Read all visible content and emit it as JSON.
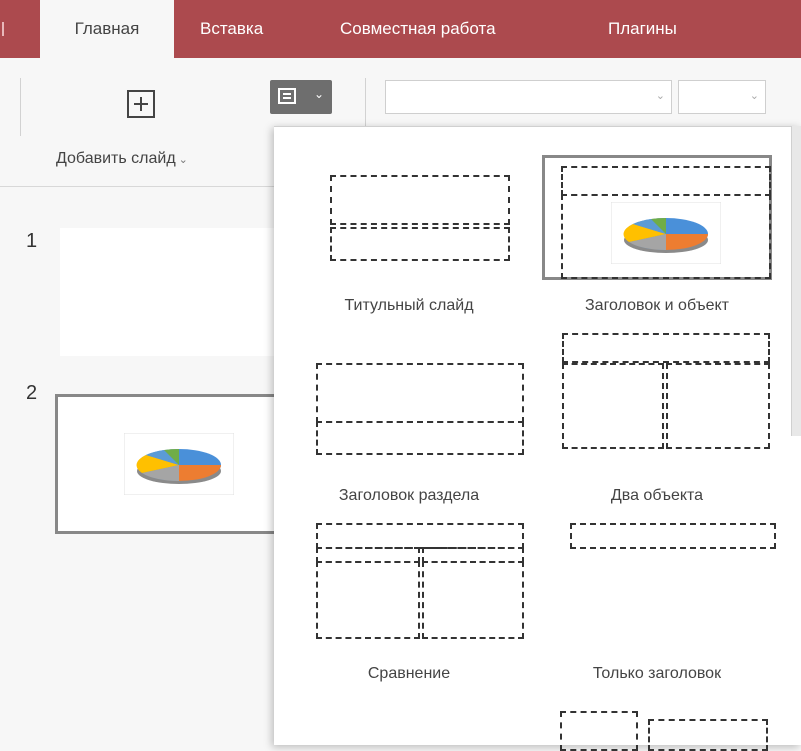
{
  "tabs": [
    {
      "label": "Главная",
      "active": true
    },
    {
      "label": "Вставка",
      "active": false
    },
    {
      "label": "Совместная работа",
      "active": false
    },
    {
      "label": "Плагины",
      "active": false
    }
  ],
  "toolbar": {
    "add_slide_label": "Добавить слайд",
    "chevron": "⌄",
    "layout_chevron": "⌄"
  },
  "slides": [
    {
      "number": "1"
    },
    {
      "number": "2"
    }
  ],
  "layouts": [
    {
      "label": "Титульный слайд",
      "selected": false
    },
    {
      "label": "Заголовок и объект",
      "selected": true
    },
    {
      "label": "Заголовок раздела",
      "selected": false
    },
    {
      "label": "Два объекта",
      "selected": false
    },
    {
      "label": "Сравнение",
      "selected": false
    },
    {
      "label": "Только заголовок",
      "selected": false
    }
  ],
  "colors": {
    "tab_bar": "#ac4a4e",
    "pie": [
      "#4a90d9",
      "#ed7d31",
      "#a5a5a5",
      "#ffc000",
      "#5b9bd5",
      "#70ad47"
    ]
  }
}
